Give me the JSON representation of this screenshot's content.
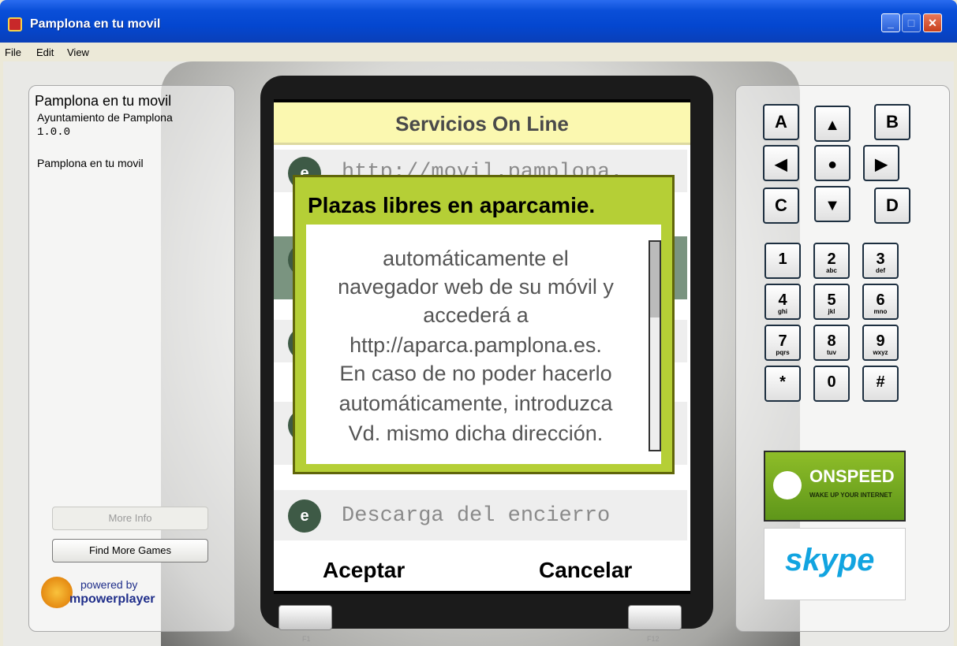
{
  "window": {
    "title": "Pamplona en tu movil"
  },
  "menu": [
    "File",
    "Edit",
    "View"
  ],
  "app_info": {
    "name": "Pamplona en tu movil",
    "company": "Ayuntamiento de Pamplona",
    "version": "1.0.0",
    "description": "Pamplona en tu movil"
  },
  "buttons": {
    "more_info": "More Info",
    "find_more": "Find More Games"
  },
  "powered": {
    "by": "powered by",
    "name": "mpowerplayer"
  },
  "screen": {
    "header": "Servicios On Line",
    "items": [
      {
        "icon": "e",
        "text": "http://movil.pamplona.",
        "selected": false
      },
      {
        "icon": "e",
        "text": "",
        "selected": true
      },
      {
        "icon": "e",
        "text": "",
        "selected": false
      },
      {
        "icon": "e",
        "text": "",
        "selected": false
      },
      {
        "icon": "e",
        "text": "Descarga del encierro",
        "selected": false
      }
    ],
    "softkey_left": "Aceptar",
    "softkey_right": "Cancelar"
  },
  "popup": {
    "title": "Plazas libres en aparcamie.",
    "lines": [
      "automáticamente el",
      "navegador web de su móvil y",
      "accederá a",
      "http://aparca.pamplona.es.",
      "En caso de no poder hacerlo",
      "automáticamente, introduzca",
      "Vd. mismo dicha dirección."
    ],
    "scroll_position": 0.0
  },
  "fkeys": {
    "left": "F1",
    "right": "F12"
  },
  "keypad": {
    "nav": {
      "a": "A",
      "b": "B",
      "c": "C",
      "d": "D"
    },
    "digits": [
      {
        "main": "1",
        "sub": ""
      },
      {
        "main": "2",
        "sub": "abc"
      },
      {
        "main": "3",
        "sub": "def"
      },
      {
        "main": "4",
        "sub": "ghi"
      },
      {
        "main": "5",
        "sub": "jkl"
      },
      {
        "main": "6",
        "sub": "mno"
      },
      {
        "main": "7",
        "sub": "pqrs"
      },
      {
        "main": "8",
        "sub": "tuv"
      },
      {
        "main": "9",
        "sub": "wxyz"
      },
      {
        "main": "*",
        "sub": ""
      },
      {
        "main": "0",
        "sub": ""
      },
      {
        "main": "#",
        "sub": ""
      }
    ]
  },
  "ads": {
    "onspeed_name": "ONSPEED",
    "onspeed_tag": "WAKE UP YOUR INTERNET",
    "skype_name": "skype"
  }
}
